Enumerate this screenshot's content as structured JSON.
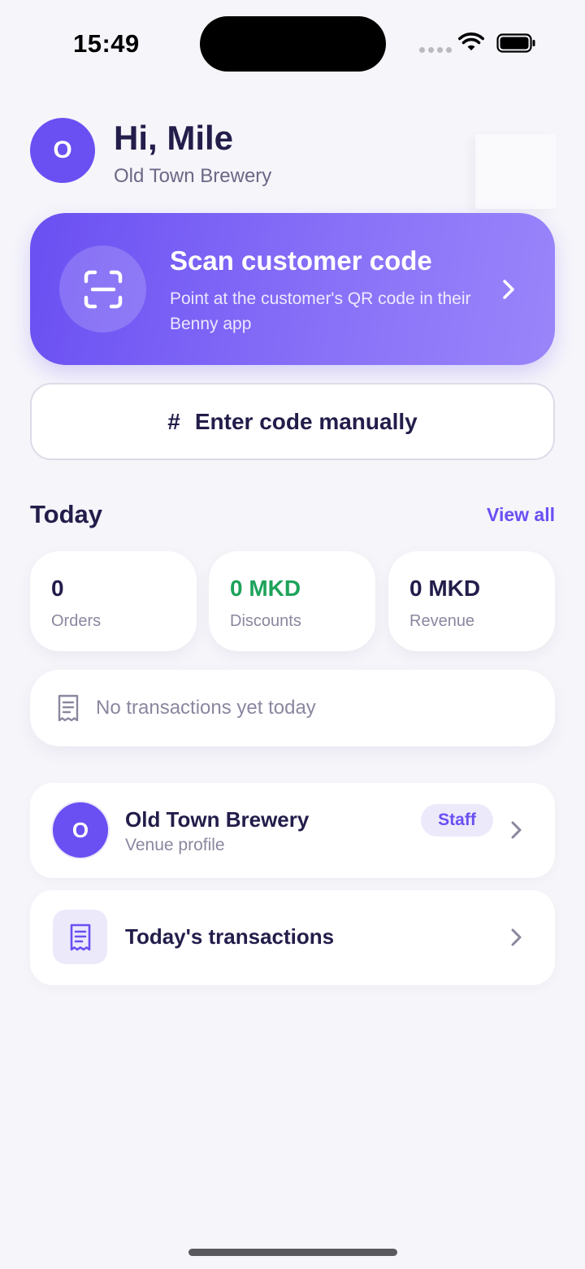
{
  "status_bar": {
    "time": "15:49"
  },
  "header": {
    "avatar_initial": "O",
    "greeting": "Hi, Mile",
    "venue_name": "Old Town Brewery"
  },
  "scan": {
    "title": "Scan customer code",
    "description": "Point at the customer's QR code in their Benny app"
  },
  "manual": {
    "icon": "#",
    "label": "Enter code manually"
  },
  "today": {
    "title": "Today",
    "view_all": "View all",
    "stats": [
      {
        "value": "0",
        "label": "Orders"
      },
      {
        "value": "0 MKD",
        "label": "Discounts"
      },
      {
        "value": "0 MKD",
        "label": "Revenue"
      }
    ],
    "empty_message": "No transactions yet today"
  },
  "venue_row": {
    "avatar_initial": "O",
    "name": "Old Town Brewery",
    "subtitle": "Venue profile",
    "badge": "Staff"
  },
  "transactions_row": {
    "label": "Today's transactions"
  },
  "colors": {
    "accent": "#6a4ff2",
    "positive": "#1ea35b",
    "text_primary": "#221d4a",
    "background": "#f5f5fa"
  }
}
